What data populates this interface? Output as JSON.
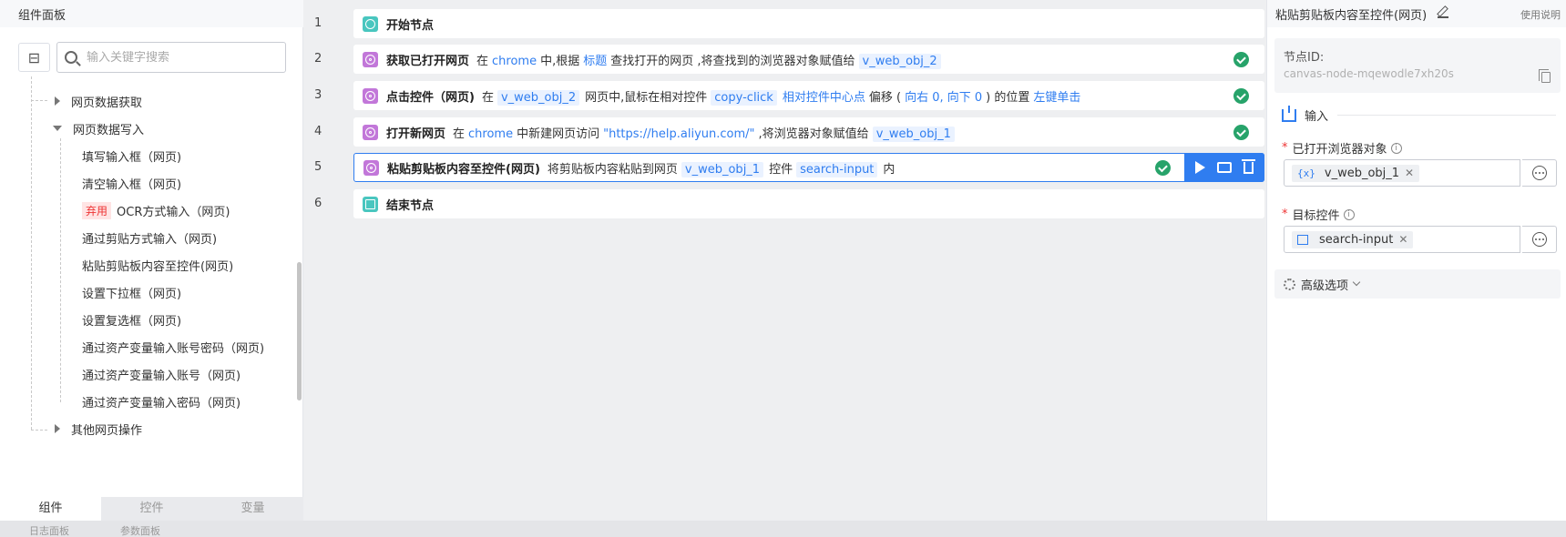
{
  "left_panel": {
    "title": "组件面板",
    "search_placeholder": "输入关键字搜索",
    "tree": [
      {
        "label": "网页数据获取"
      },
      {
        "label": "网页数据写入"
      },
      {
        "label": "填写输入框（网页)"
      },
      {
        "label": "清空输入框（网页)"
      },
      {
        "badge": "弃用",
        "label": "OCR方式输入（网页)"
      },
      {
        "label": "通过剪贴方式输入（网页)"
      },
      {
        "label": "粘贴剪贴板内容至控件(网页)"
      },
      {
        "label": "设置下拉框（网页)"
      },
      {
        "label": "设置复选框（网页)"
      },
      {
        "label": "通过资产变量输入账号密码（网页)"
      },
      {
        "label": "通过资产变量输入账号（网页)"
      },
      {
        "label": "通过资产变量输入密码（网页)"
      },
      {
        "label": "其他网页操作"
      }
    ],
    "tabs": [
      "组件",
      "控件",
      "变量"
    ],
    "active_tab": "组件"
  },
  "status_bar": {
    "log_panel": "日志面板",
    "param_panel": "参数面板"
  },
  "flow": {
    "rows": [
      {
        "num": "1",
        "title": "开始节点",
        "type": "start"
      },
      {
        "num": "2",
        "title": "获取已打开网页",
        "type": "web",
        "status": "success",
        "parts": [
          {
            "k": "norm",
            "t": "在"
          },
          {
            "k": "link",
            "t": "chrome"
          },
          {
            "k": "norm",
            "t": "中,根据"
          },
          {
            "k": "link",
            "t": "标题"
          },
          {
            "k": "norm",
            "t": "查找打开的网页 ,将查找到的浏览器对象赋值给"
          },
          {
            "k": "tag",
            "t": "v_web_obj_2"
          }
        ]
      },
      {
        "num": "3",
        "title": "点击控件（网页)",
        "type": "web",
        "status": "success",
        "parts": [
          {
            "k": "norm",
            "t": "在"
          },
          {
            "k": "tag",
            "t": "v_web_obj_2"
          },
          {
            "k": "norm",
            "t": "网页中,鼠标在相对控件"
          },
          {
            "k": "tag",
            "t": "copy-click"
          },
          {
            "k": "link",
            "t": "相对控件中心点"
          },
          {
            "k": "norm",
            "t": "偏移 ("
          },
          {
            "k": "link",
            "t": "向右 0, 向下 0"
          },
          {
            "k": "norm",
            "t": ") 的位置"
          },
          {
            "k": "link",
            "t": "左键单击"
          }
        ]
      },
      {
        "num": "4",
        "title": "打开新网页",
        "type": "web",
        "status": "success",
        "parts": [
          {
            "k": "norm",
            "t": "在"
          },
          {
            "k": "link",
            "t": "chrome"
          },
          {
            "k": "norm",
            "t": "中新建网页访问"
          },
          {
            "k": "link",
            "t": "\"https://help.aliyun.com/\""
          },
          {
            "k": "norm",
            "t": ",将浏览器对象赋值给"
          },
          {
            "k": "tag",
            "t": "v_web_obj_1"
          }
        ]
      },
      {
        "num": "5",
        "title": "粘贴剪贴板内容至控件(网页)",
        "type": "web",
        "status": "success",
        "selected": true,
        "parts": [
          {
            "k": "norm",
            "t": "将剪贴板内容粘贴到网页"
          },
          {
            "k": "tag",
            "t": "v_web_obj_1"
          },
          {
            "k": "norm",
            "t": "控件"
          },
          {
            "k": "tag",
            "t": "search-input"
          },
          {
            "k": "norm",
            "t": "内"
          }
        ]
      },
      {
        "num": "6",
        "title": "结束节点",
        "type": "end"
      }
    ]
  },
  "right_panel": {
    "title": "粘贴剪贴板内容至控件(网页)",
    "help": "使用说明",
    "node_id_label": "节点ID:",
    "node_id_value": "canvas-node-mqewodle7xh20s",
    "input_section": "输入",
    "field1": {
      "label": "已打开浏览器对象",
      "icon": "{x}",
      "value": "v_web_obj_1"
    },
    "field2": {
      "label": "目标控件",
      "value": "search-input"
    },
    "advanced": "高级选项"
  },
  "colors": {
    "accent": "#2f7df0",
    "success": "#27a36a",
    "node_web": "#c277d9",
    "node_start": "#49c6bf"
  }
}
